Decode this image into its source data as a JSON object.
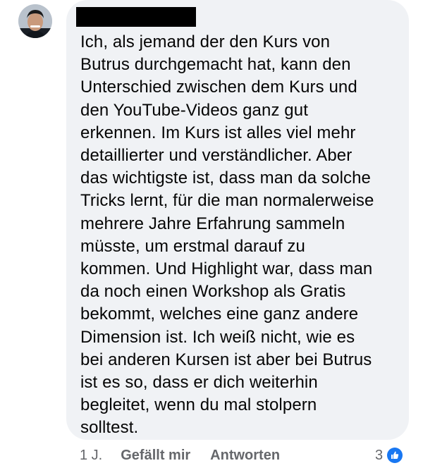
{
  "comment": {
    "avatar": {
      "icon": "user-avatar"
    },
    "author": {
      "name_hidden": true
    },
    "text": "Ich, als jemand der den Kurs von\nButrus durchgemacht hat, kann den\nUnterschied zwischen dem Kurs und\nden YouTube-Videos ganz gut\nerkennen. Im Kurs ist alles viel mehr\ndetaillierter und verständlicher. Aber\ndas wichtigste ist, dass man da solche\nTricks lernt, für die man normalerweise\nmehrere Jahre Erfahrung sammeln\nmüsste, um erstmal darauf zu\nkommen. Und Highlight war, dass man\nda noch einen Workshop als Gratis\nbekommt, welches eine ganz andere\nDimension ist. Ich weiß nicht, wie es\nbei anderen Kursen ist aber bei Butrus\nist es so, dass er dich weiterhin\nbegleitet, wenn du mal stolpern\nsolltest."
  },
  "actions": {
    "timestamp": "1 J.",
    "like_label": "Gefällt mir",
    "reply_label": "Antworten"
  },
  "reactions": {
    "count": "3",
    "icon": "like-icon",
    "color": "#1877f2"
  },
  "colors": {
    "bubble": "#f0f2f5",
    "text": "#050505",
    "secondary_text": "#65676b",
    "redaction": "#000000"
  }
}
